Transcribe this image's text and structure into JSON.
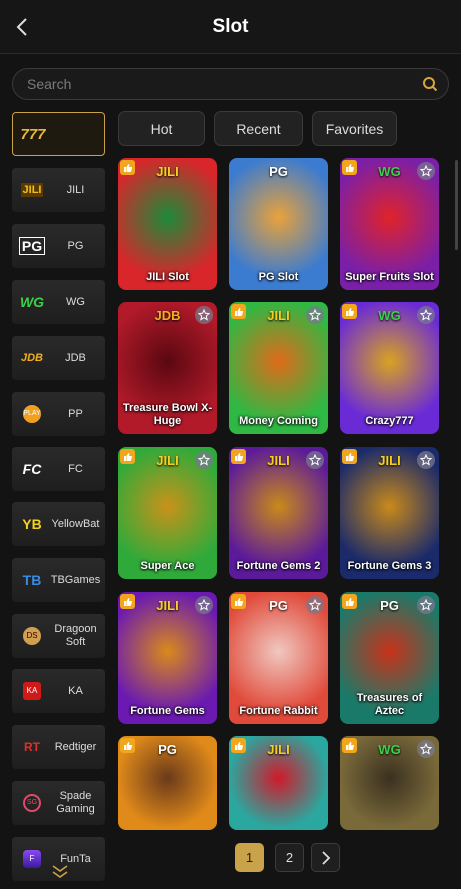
{
  "header": {
    "title": "Slot"
  },
  "search": {
    "placeholder": "Search"
  },
  "sidebar": {
    "items": [
      {
        "label": "",
        "logo": "777",
        "active": true
      },
      {
        "label": "JILI",
        "logo": "JILI"
      },
      {
        "label": "PG",
        "logo": "PG"
      },
      {
        "label": "WG",
        "logo": "WG"
      },
      {
        "label": "JDB",
        "logo": "JDB"
      },
      {
        "label": "PP",
        "logo": "PP"
      },
      {
        "label": "FC",
        "logo": "FC"
      },
      {
        "label": "YellowBat",
        "logo": "YB"
      },
      {
        "label": "TBGames",
        "logo": "TB"
      },
      {
        "label": "Dragoon Soft",
        "logo": "DS"
      },
      {
        "label": "KA",
        "logo": "KA"
      },
      {
        "label": "Redtiger",
        "logo": "RT"
      },
      {
        "label": "Spade Gaming",
        "logo": "SG"
      },
      {
        "label": "FunTa",
        "logo": "FT"
      }
    ]
  },
  "tabs": [
    {
      "label": "Hot",
      "active": true
    },
    {
      "label": "Recent",
      "active": false
    },
    {
      "label": "Favorites",
      "active": false
    }
  ],
  "games": [
    {
      "name": "JILI Slot",
      "brand": "JILI",
      "hot": true,
      "fav": false,
      "colors": [
        "#d9262b",
        "#1c8a3a"
      ]
    },
    {
      "name": "PG Slot",
      "brand": "PG",
      "hot": false,
      "fav": false,
      "colors": [
        "#3b7bd0",
        "#e9a23a"
      ]
    },
    {
      "name": "Super Fruits Slot",
      "brand": "WG",
      "hot": true,
      "fav": true,
      "colors": [
        "#7a1fa8",
        "#e0232a"
      ]
    },
    {
      "name": "Treasure Bowl X-Huge",
      "brand": "JDB",
      "hot": false,
      "fav": true,
      "colors": [
        "#b21a2a",
        "#5a0810"
      ]
    },
    {
      "name": "Money Coming",
      "brand": "JILI",
      "hot": true,
      "fav": true,
      "colors": [
        "#2fb843",
        "#e06a1a"
      ]
    },
    {
      "name": "Crazy777",
      "brand": "WG",
      "hot": true,
      "fav": true,
      "colors": [
        "#6a2bd6",
        "#d9a320"
      ]
    },
    {
      "name": "Super Ace",
      "brand": "JILI",
      "hot": true,
      "fav": true,
      "colors": [
        "#2faa3a",
        "#c9921a"
      ]
    },
    {
      "name": "Fortune Gems 2",
      "brand": "JILI",
      "hot": true,
      "fav": true,
      "colors": [
        "#5b1a9a",
        "#c98a1a"
      ]
    },
    {
      "name": "Fortune Gems 3",
      "brand": "JILI",
      "hot": true,
      "fav": true,
      "colors": [
        "#1a2a6a",
        "#c98a1a"
      ]
    },
    {
      "name": "Fortune Gems",
      "brand": "JILI",
      "hot": true,
      "fav": true,
      "colors": [
        "#6a1ab0",
        "#d98a1a"
      ]
    },
    {
      "name": "Fortune Rabbit",
      "brand": "PG",
      "hot": true,
      "fav": true,
      "colors": [
        "#e04a3a",
        "#f0c8c0"
      ]
    },
    {
      "name": "Treasures of Aztec",
      "brand": "PG",
      "hot": true,
      "fav": true,
      "colors": [
        "#1a7a6a",
        "#c9321a"
      ]
    },
    {
      "name": "",
      "brand": "PG",
      "hot": true,
      "fav": false,
      "colors": [
        "#e08a1a",
        "#6a3a1a"
      ]
    },
    {
      "name": "",
      "brand": "JILI",
      "hot": true,
      "fav": false,
      "colors": [
        "#2aa8a0",
        "#d01a2a"
      ]
    },
    {
      "name": "",
      "brand": "WG",
      "hot": true,
      "fav": true,
      "colors": [
        "#7a6a3a",
        "#3a3020"
      ]
    }
  ],
  "pagination": {
    "pages": [
      "1",
      "2"
    ],
    "current": "1",
    "next_label": "›"
  },
  "colors": {
    "accent": "#c9a24a",
    "background": "#131313",
    "hot": "#f2a61d"
  }
}
